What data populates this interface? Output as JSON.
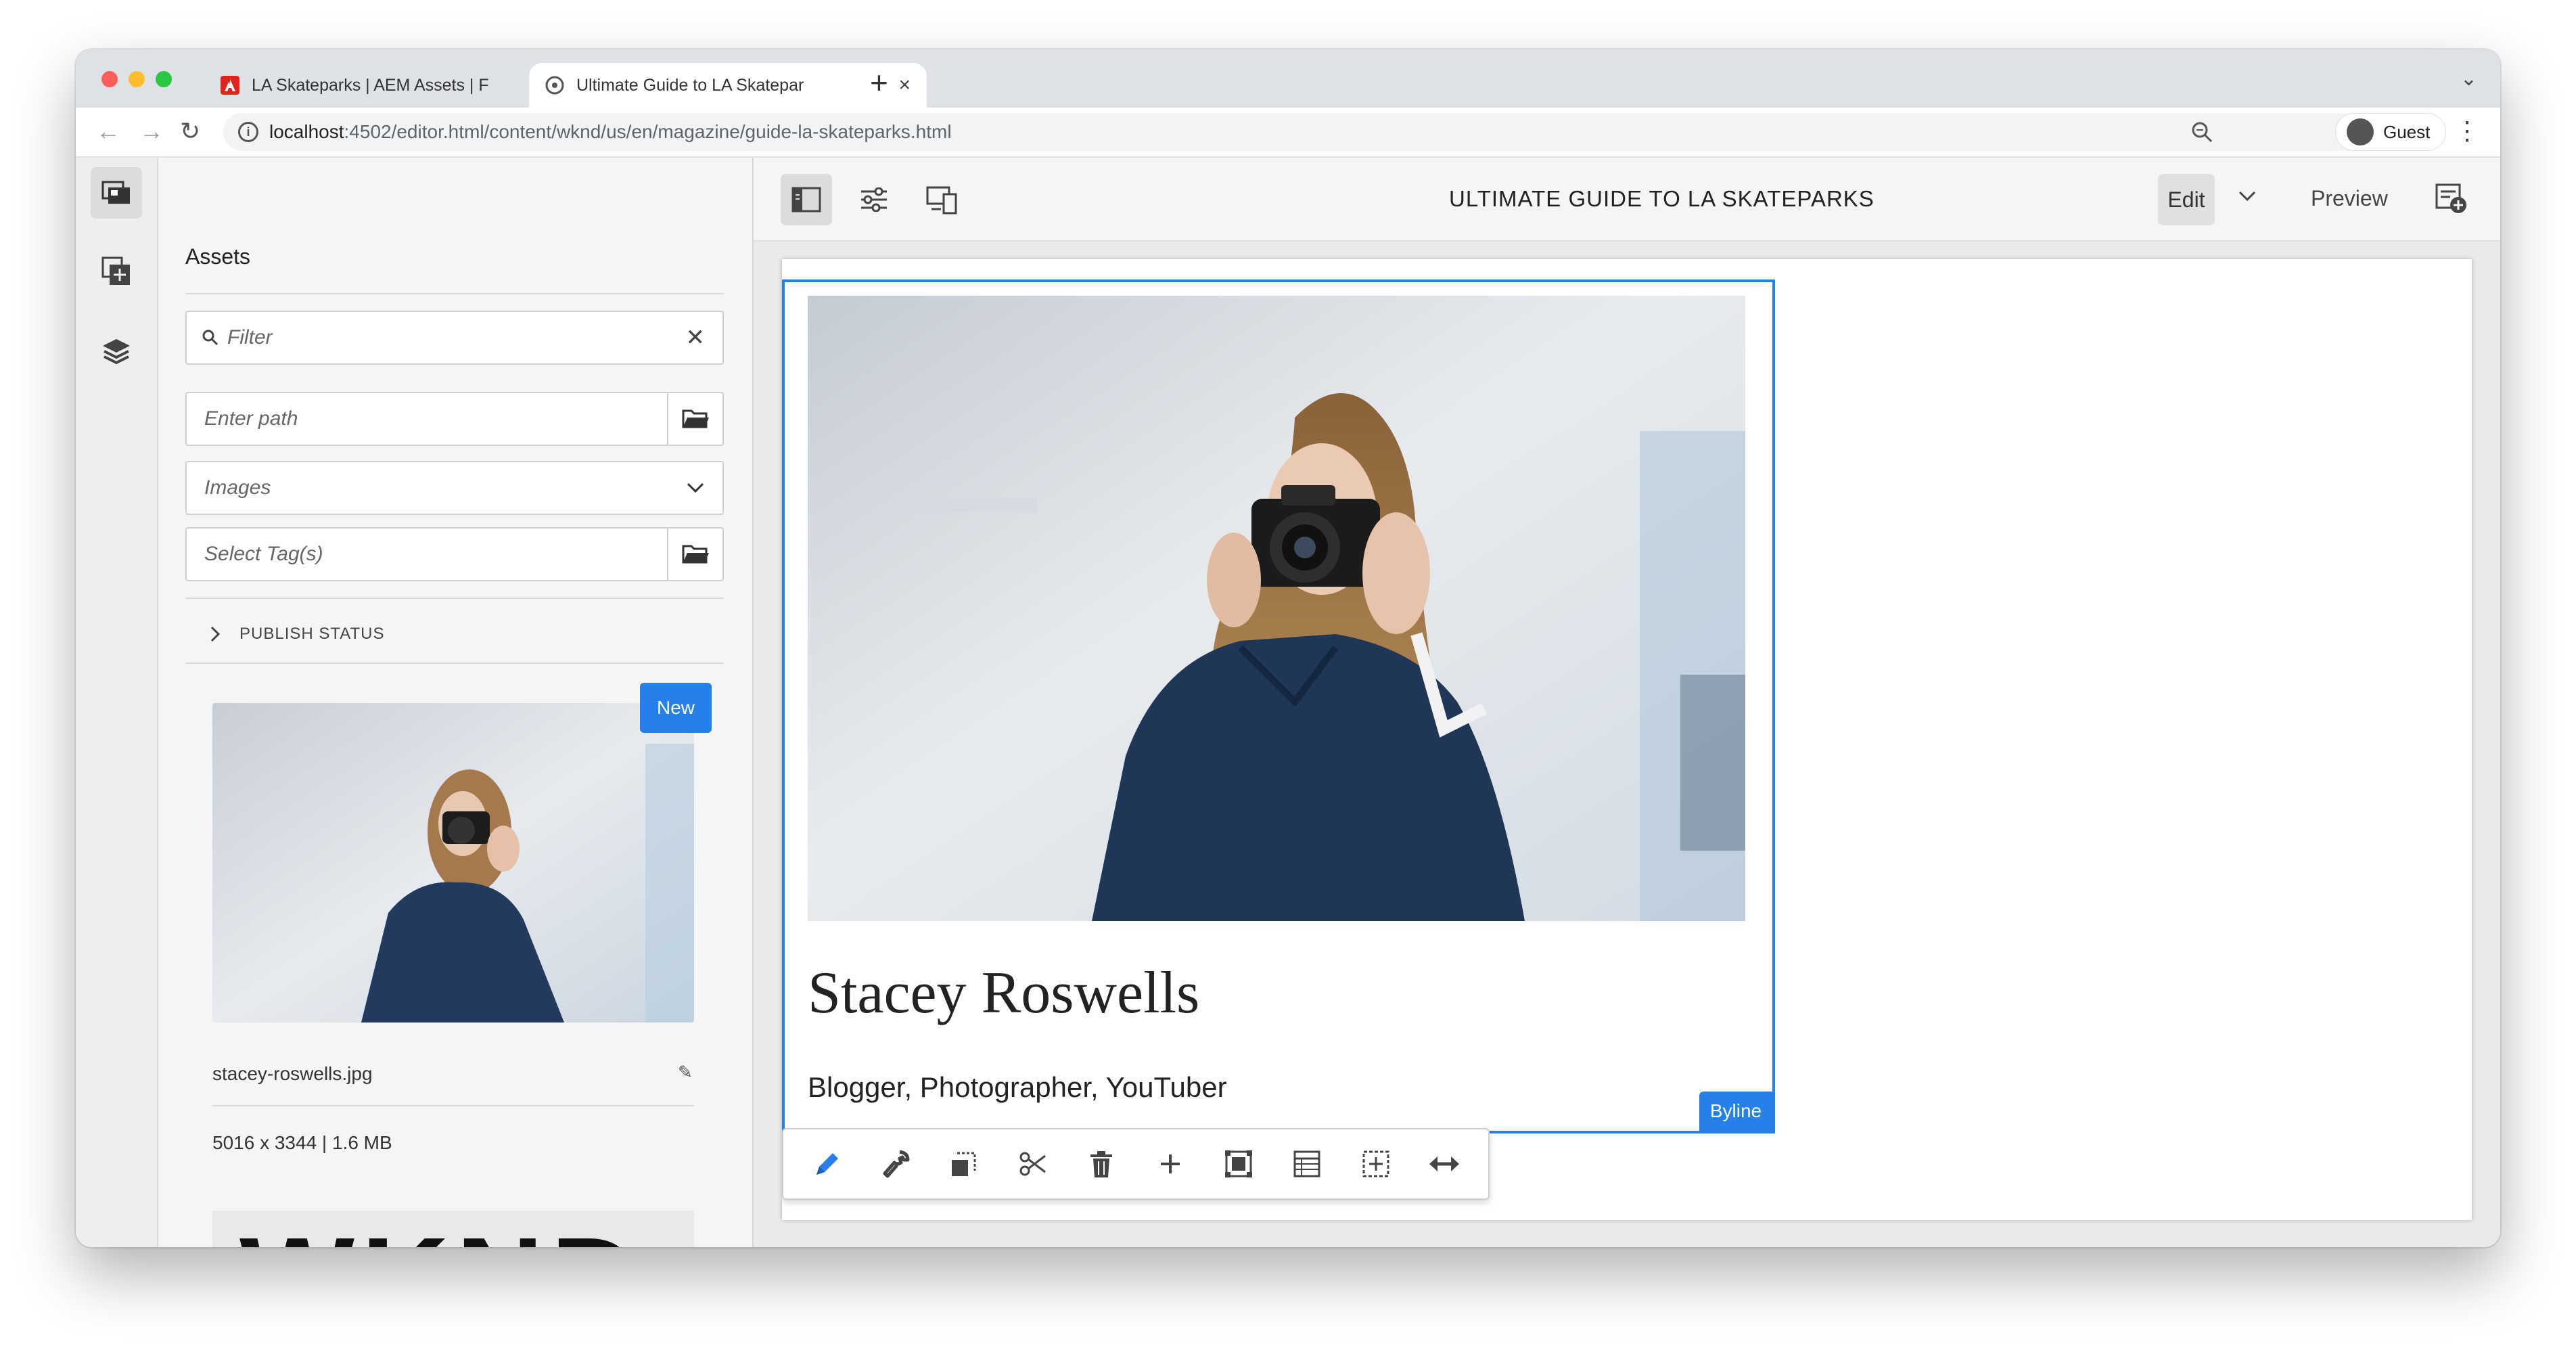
{
  "browser": {
    "tabs": [
      {
        "title": "LA Skateparks | AEM Assets | F",
        "favicon": "adobe-icon",
        "close": "×"
      },
      {
        "title": "Ultimate Guide to LA Skatepar",
        "favicon": "globe-icon",
        "close": "×"
      }
    ],
    "new_tab": "+",
    "url_host": "localhost",
    "url_rest": ":4502/editor.html/content/wknd/us/en/magazine/guide-la-skateparks.html",
    "profile": "Guest"
  },
  "rail": {
    "items": [
      "assets-finder-icon",
      "components-icon",
      "content-tree-icon"
    ]
  },
  "assets_panel": {
    "title": "Assets",
    "filter_placeholder": "Filter",
    "path_placeholder": "Enter path",
    "type_value": "Images",
    "tags_placeholder": "Select Tag(s)",
    "publish_status": "PUBLISH STATUS",
    "asset": {
      "badge": "New",
      "filename": "stacey-roswells.jpg",
      "meta": "5016 x 3344 | 1.6 MB"
    },
    "next_asset_text": "WKND"
  },
  "editor": {
    "page_title": "ULTIMATE GUIDE TO LA SKATEPARKS",
    "mode": "Edit",
    "preview": "Preview",
    "byline": {
      "name": "Stacey Roswells",
      "occupations": "Blogger, Photographer, YouTuber",
      "label": "Byline"
    },
    "component_toolbar": [
      "edit-icon",
      "configure-icon",
      "parent-icon",
      "cut-icon",
      "delete-icon",
      "insert-icon",
      "group-icon",
      "layout-icon",
      "paste-icon",
      "resize-icon"
    ]
  },
  "colors": {
    "accent": "#2680eb",
    "chrome_bg": "#dee1e6",
    "panel_bg": "#f5f5f5"
  }
}
